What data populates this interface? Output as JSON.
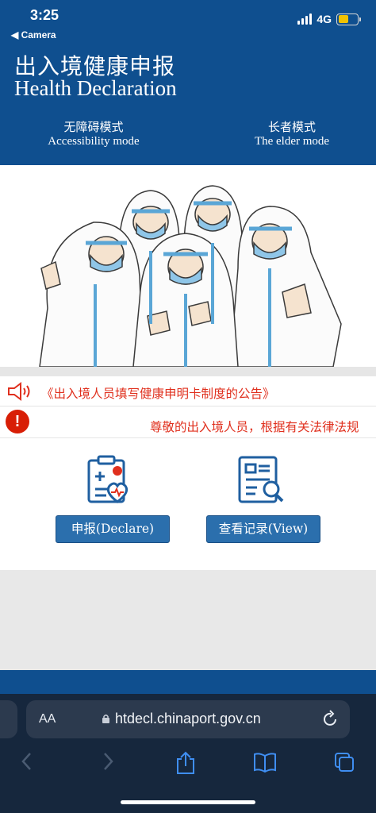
{
  "status": {
    "time": "3:25",
    "back_label": "◀ Camera",
    "network": "4G",
    "battery_color": "#f2c200"
  },
  "header": {
    "title_cn": "出入境健康申报",
    "title_en": "Health Declaration",
    "mode_accessibility_cn": "无障碍模式",
    "mode_accessibility_en": "Accessibility mode",
    "mode_elder_cn": "长者模式",
    "mode_elder_en": "The elder mode"
  },
  "notices": {
    "announcement": "《出入境人员填写健康申明卡制度的公告》",
    "scrolling": "尊敬的出入境人员，根据有关法律法规"
  },
  "actions": {
    "declare_label": "申报(Declare)",
    "view_label": "查看记录(View)"
  },
  "browser": {
    "aa_label": "AA",
    "url": "htdecl.chinaport.gov.cn"
  },
  "colors": {
    "brand_blue": "#0f4f8f",
    "alert_red": "#e0301e",
    "button_blue": "#2b6fad"
  }
}
